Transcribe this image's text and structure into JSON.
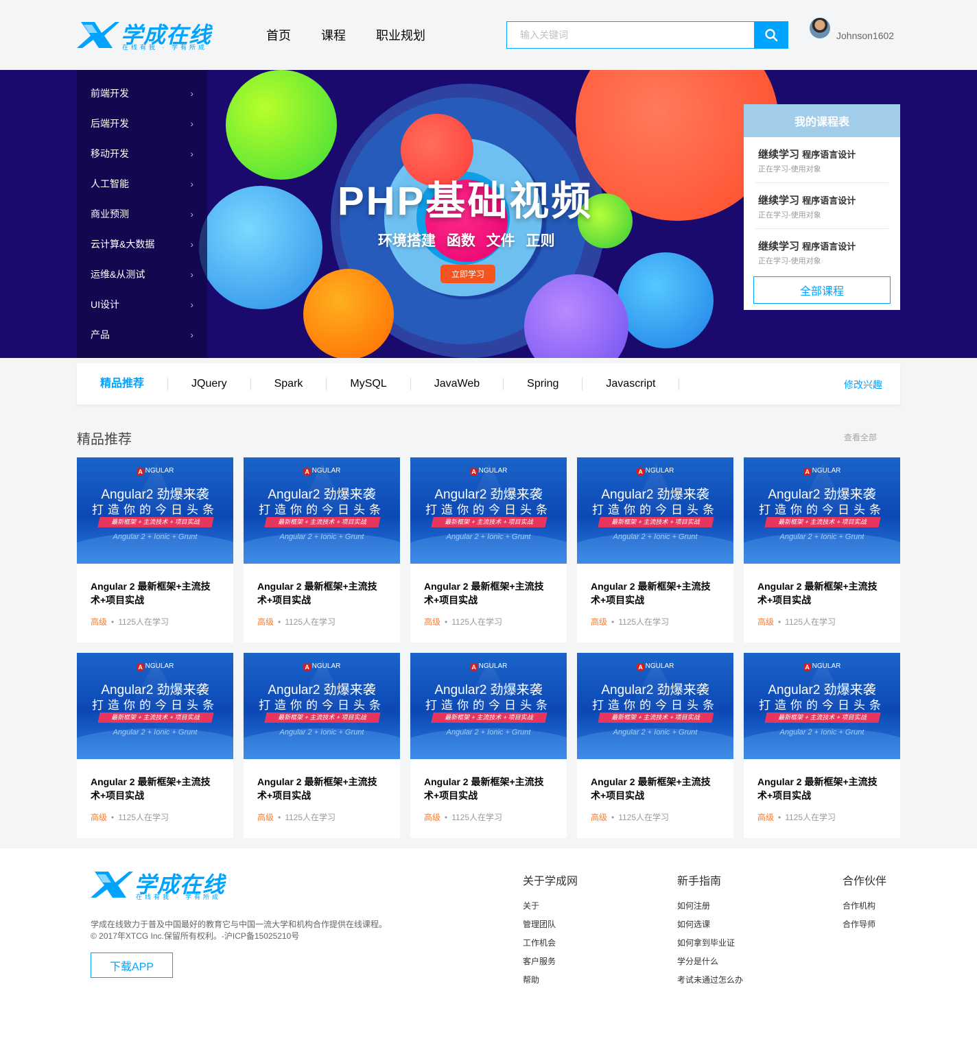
{
  "header": {
    "logo_title": "学成在线",
    "logo_slogan": "在线有我 · 学有所成",
    "nav": [
      "首页",
      "课程",
      "职业规划"
    ],
    "search_placeholder": "输入关键词",
    "username": "Johnson1602"
  },
  "banner": {
    "sidebar": [
      "前端开发",
      "后端开发",
      "移动开发",
      "人工智能",
      "商业预测",
      "云计算&大数据",
      "运维&从测试",
      "UI设计",
      "产品"
    ],
    "title": "PHP基础视频",
    "subtitle": "环境搭建  函数 文件  正则",
    "button": "立即学习"
  },
  "mycourse": {
    "heading": "我的课程表",
    "items": [
      {
        "lead": "继续学习",
        "name": "程序语言设计",
        "status": "正在学习-使用对象"
      },
      {
        "lead": "继续学习",
        "name": "程序语言设计",
        "status": "正在学习-使用对象"
      },
      {
        "lead": "继续学习",
        "name": "程序语言设计",
        "status": "正在学习-使用对象"
      }
    ],
    "all_button": "全部课程"
  },
  "tabs": {
    "items": [
      "精品推荐",
      "JQuery",
      "Spark",
      "MySQL",
      "JavaWeb",
      "Spring",
      "Javascript"
    ],
    "active": 0,
    "edit": "修改兴趣"
  },
  "section": {
    "title": "精品推荐",
    "more": "查看全部"
  },
  "course_thumb": {
    "brand": "NGULAR",
    "headline1": "Angular2 劲爆来袭",
    "headline2": "打造你的今日头条",
    "strip": "最新框架 + 主流技术 + 项目实战",
    "stack": "Angular 2 + Ionic + Grunt"
  },
  "courses": [
    {
      "title": "Angular 2 最新框架+主流技术+项目实战",
      "level": "高级",
      "students": "1125人在学习"
    },
    {
      "title": "Angular 2 最新框架+主流技术+项目实战",
      "level": "高级",
      "students": "1125人在学习"
    },
    {
      "title": "Angular 2 最新框架+主流技术+项目实战",
      "level": "高级",
      "students": "1125人在学习"
    },
    {
      "title": "Angular 2 最新框架+主流技术+项目实战",
      "level": "高级",
      "students": "1125人在学习"
    },
    {
      "title": "Angular 2 最新框架+主流技术+项目实战",
      "level": "高级",
      "students": "1125人在学习"
    },
    {
      "title": "Angular 2 最新框架+主流技术+项目实战",
      "level": "高级",
      "students": "1125人在学习"
    },
    {
      "title": "Angular 2 最新框架+主流技术+项目实战",
      "level": "高级",
      "students": "1125人在学习"
    },
    {
      "title": "Angular 2 最新框架+主流技术+项目实战",
      "level": "高级",
      "students": "1125人在学习"
    },
    {
      "title": "Angular 2 最新框架+主流技术+项目实战",
      "level": "高级",
      "students": "1125人在学习"
    },
    {
      "title": "Angular 2 最新框架+主流技术+项目实战",
      "level": "高级",
      "students": "1125人在学习"
    }
  ],
  "footer": {
    "desc1": "学成在线致力于普及中国最好的教育它与中国一流大学和机构合作提供在线课程。",
    "desc2": "© 2017年XTCG Inc.保留所有权利。-沪ICP备15025210号",
    "app_button": "下载APP",
    "columns": [
      {
        "heading": "关于学成网",
        "links": [
          "关于",
          "管理团队",
          "工作机会",
          "客户服务",
          "帮助"
        ]
      },
      {
        "heading": "新手指南",
        "links": [
          "如何注册",
          "如何选课",
          "如何拿到毕业证",
          "学分是什么",
          "考试未通过怎么办"
        ]
      },
      {
        "heading": "合作伙伴",
        "links": [
          "合作机构",
          "合作导师"
        ]
      }
    ]
  },
  "colors": {
    "accent": "#00a4ff",
    "banner_bg": "#1b0a6e",
    "level": "#ff7c2d",
    "cta": "#f5531f",
    "panel_head": "#a2cdea"
  },
  "icons": [
    "logo-x-icon",
    "search-icon",
    "chevron-right-icon",
    "angular-icon"
  ]
}
